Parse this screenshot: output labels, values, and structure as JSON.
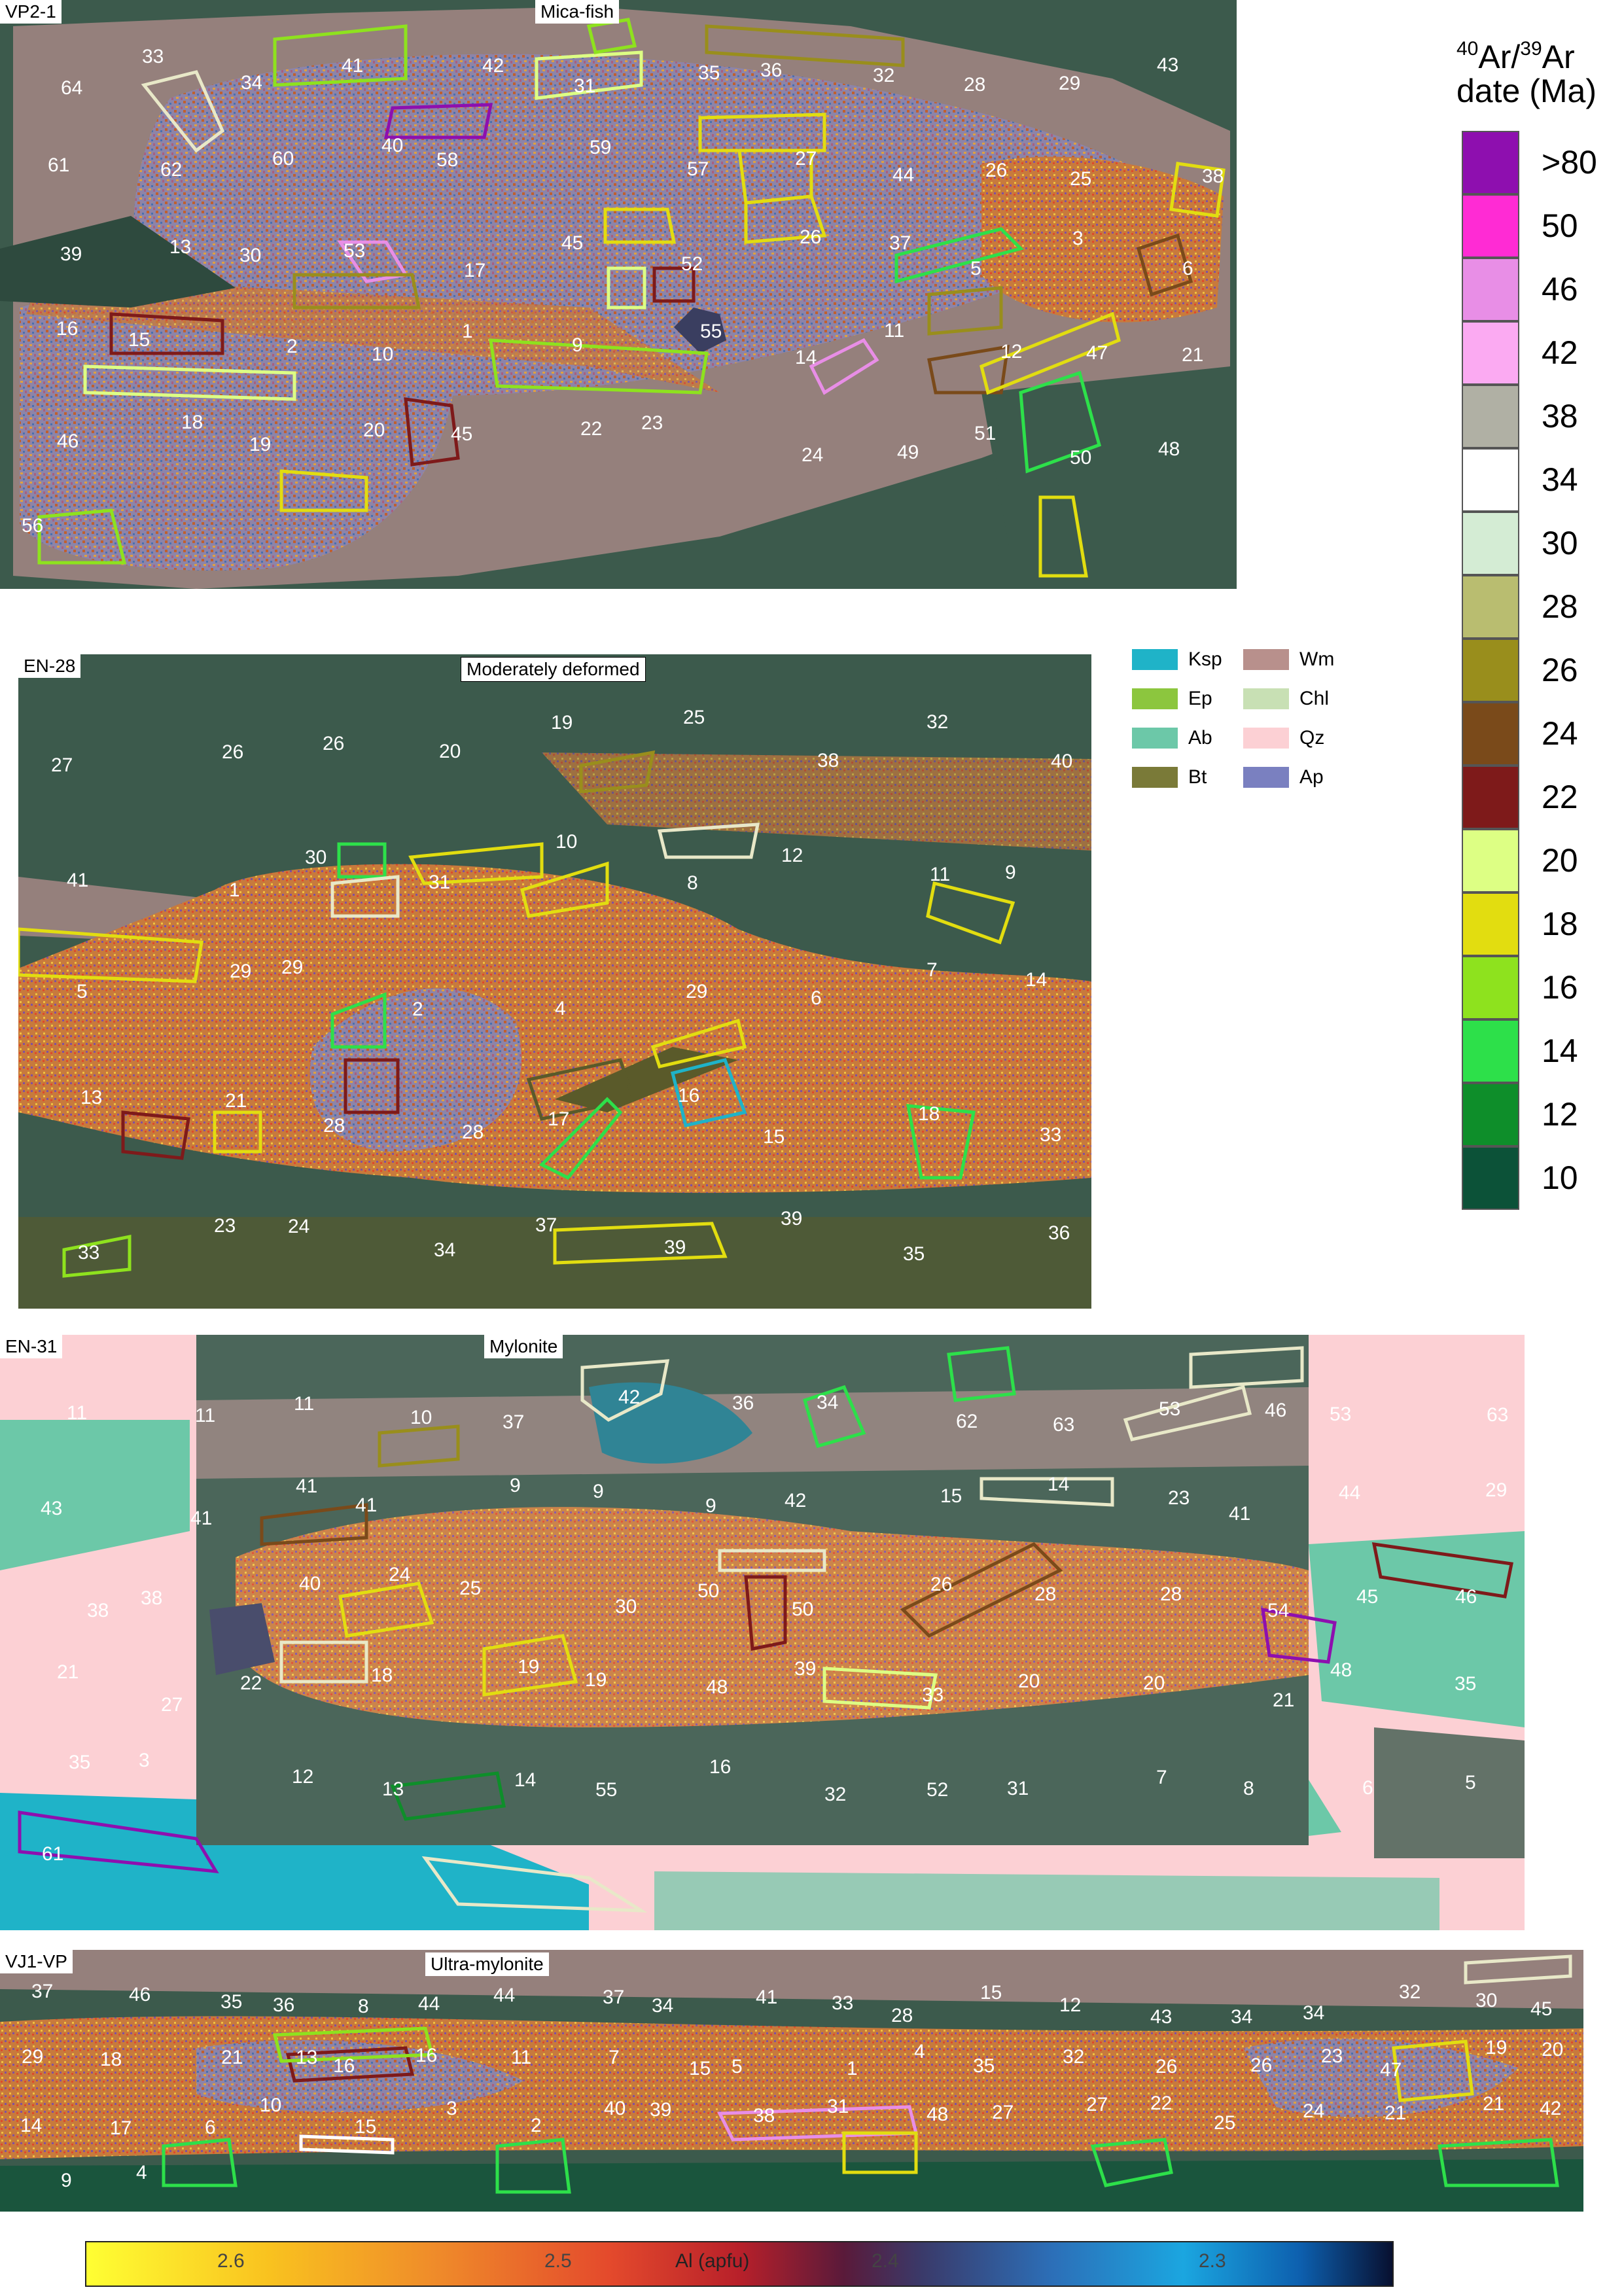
{
  "panels": [
    {
      "id": "VP2-1",
      "title": "Mica-fish",
      "numbers": [
        "64",
        "33",
        "34",
        "41",
        "42",
        "31",
        "35",
        "36",
        "32",
        "28",
        "29",
        "43",
        "61",
        "62",
        "60",
        "40",
        "58",
        "59",
        "57",
        "27",
        "44",
        "26",
        "25",
        "38",
        "39",
        "13",
        "30",
        "53",
        "17",
        "45",
        "52",
        "26",
        "37",
        "5",
        "3",
        "6",
        "16",
        "15",
        "2",
        "10",
        "1",
        "9",
        "55",
        "14",
        "11",
        "12",
        "47",
        "21",
        "46",
        "18",
        "19",
        "20",
        "45",
        "22",
        "23",
        "24",
        "49",
        "51",
        "50",
        "48",
        "56"
      ]
    },
    {
      "id": "EN-28",
      "title": "Moderately deformed",
      "numbers": [
        "27",
        "26",
        "26",
        "20",
        "19",
        "25",
        "38",
        "32",
        "40",
        "41",
        "1",
        "30",
        "31",
        "10",
        "8",
        "12",
        "11",
        "9",
        "5",
        "29",
        "29",
        "2",
        "4",
        "29",
        "6",
        "7",
        "14",
        "13",
        "21",
        "28",
        "28",
        "17",
        "16",
        "15",
        "18",
        "33",
        "33",
        "23",
        "24",
        "34",
        "37",
        "39",
        "39",
        "35",
        "36"
      ]
    },
    {
      "id": "EN-31",
      "title": "Mylonite",
      "numbers": [
        "11",
        "11",
        "11",
        "10",
        "37",
        "42",
        "36",
        "34",
        "62",
        "63",
        "53",
        "46",
        "53",
        "63",
        "43",
        "41",
        "41",
        "41",
        "9",
        "9",
        "9",
        "42",
        "15",
        "14",
        "23",
        "41",
        "44",
        "29",
        "38",
        "38",
        "40",
        "24",
        "25",
        "30",
        "50",
        "50",
        "26",
        "28",
        "28",
        "54",
        "45",
        "46",
        "21",
        "27",
        "22",
        "18",
        "19",
        "19",
        "48",
        "39",
        "33",
        "20",
        "20",
        "21",
        "48",
        "35",
        "35",
        "3",
        "12",
        "13",
        "14",
        "55",
        "16",
        "32",
        "52",
        "31",
        "7",
        "8",
        "6",
        "5",
        "61"
      ]
    },
    {
      "id": "VJ1-VP",
      "title": "Ultra-mylonite",
      "numbers": [
        "37",
        "46",
        "35",
        "36",
        "8",
        "44",
        "44",
        "37",
        "34",
        "41",
        "33",
        "28",
        "15",
        "12",
        "43",
        "34",
        "34",
        "32",
        "30",
        "45",
        "29",
        "18",
        "21",
        "13",
        "16",
        "16",
        "11",
        "7",
        "15",
        "5",
        "1",
        "4",
        "35",
        "32",
        "26",
        "26",
        "23",
        "47",
        "19",
        "20",
        "14",
        "17",
        "6",
        "10",
        "15",
        "3",
        "2",
        "40",
        "39",
        "38",
        "31",
        "48",
        "27",
        "27",
        "22",
        "25",
        "24",
        "21",
        "21",
        "42",
        "9",
        "4"
      ]
    }
  ],
  "date_legend": {
    "title_iso_a": "40",
    "title_ar1": "Ar/",
    "title_iso_b": "39",
    "title_ar2": "Ar",
    "title_line2": "date (Ma)",
    "items": [
      {
        "label": ">80",
        "color": "#8e0faf"
      },
      {
        "label": "50",
        "color": "#ff2bd4"
      },
      {
        "label": "46",
        "color": "#e88ee6"
      },
      {
        "label": "42",
        "color": "#fbaaf2"
      },
      {
        "label": "38",
        "color": "#b0b0a4"
      },
      {
        "label": "34",
        "color": "#ffffff"
      },
      {
        "label": "30",
        "color": "#d4ecd4"
      },
      {
        "label": "28",
        "color": "#b9bd70"
      },
      {
        "label": "26",
        "color": "#998e1c"
      },
      {
        "label": "24",
        "color": "#7a4a1a"
      },
      {
        "label": "22",
        "color": "#7e1a1a"
      },
      {
        "label": "20",
        "color": "#ddff84"
      },
      {
        "label": "18",
        "color": "#e2dd10"
      },
      {
        "label": "16",
        "color": "#8ee21e"
      },
      {
        "label": "14",
        "color": "#2de04a"
      },
      {
        "label": "12",
        "color": "#0e8e2a"
      },
      {
        "label": "10",
        "color": "#0c5238"
      }
    ]
  },
  "mineral_legend": [
    {
      "label": "Ksp",
      "color": "#1fb3c8"
    },
    {
      "label": "Wm",
      "color": "#b8908c"
    },
    {
      "label": "Ep",
      "color": "#8cc63e"
    },
    {
      "label": "Chl",
      "color": "#c8e0b4"
    },
    {
      "label": "Ab",
      "color": "#6cc8a8"
    },
    {
      "label": "Qz",
      "color": "#fcd0d4"
    },
    {
      "label": "Bt",
      "color": "#7a7a38"
    },
    {
      "label": "Ap",
      "color": "#7a80c0"
    }
  ],
  "al_colorbar": {
    "ticks": [
      "2.6",
      "2.5",
      "2.4",
      "2.3"
    ],
    "label": "Al (apfu)"
  }
}
